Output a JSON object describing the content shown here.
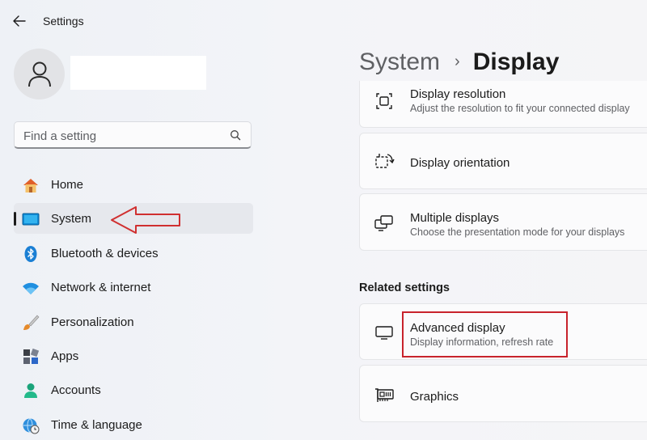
{
  "window": {
    "title": "Settings"
  },
  "search": {
    "placeholder": "Find a setting"
  },
  "nav": {
    "items": [
      {
        "label": "Home",
        "icon": "home-icon"
      },
      {
        "label": "System",
        "icon": "system-icon",
        "selected": true
      },
      {
        "label": "Bluetooth & devices",
        "icon": "bluetooth-icon"
      },
      {
        "label": "Network & internet",
        "icon": "wifi-icon"
      },
      {
        "label": "Personalization",
        "icon": "brush-icon"
      },
      {
        "label": "Apps",
        "icon": "apps-icon"
      },
      {
        "label": "Accounts",
        "icon": "accounts-icon"
      },
      {
        "label": "Time & language",
        "icon": "time-language-icon"
      }
    ]
  },
  "breadcrumb": {
    "parent": "System",
    "separator": "›",
    "current": "Display"
  },
  "display_cards": [
    {
      "title": "Display resolution",
      "subtitle": "Adjust the resolution to fit your connected display",
      "icon": "resolution-icon"
    },
    {
      "title": "Display orientation",
      "icon": "orientation-icon"
    },
    {
      "title": "Multiple displays",
      "subtitle": "Choose the presentation mode for your displays",
      "icon": "multiple-displays-icon"
    }
  ],
  "related": {
    "heading": "Related settings",
    "cards": [
      {
        "title": "Advanced display",
        "subtitle": "Display information, refresh rate",
        "icon": "monitor-icon"
      },
      {
        "title": "Graphics",
        "icon": "graphics-card-icon"
      }
    ]
  },
  "colors": {
    "accent": "#0067c0",
    "highlight": "#c8232c",
    "selected_bg": "#e6e8ed"
  }
}
